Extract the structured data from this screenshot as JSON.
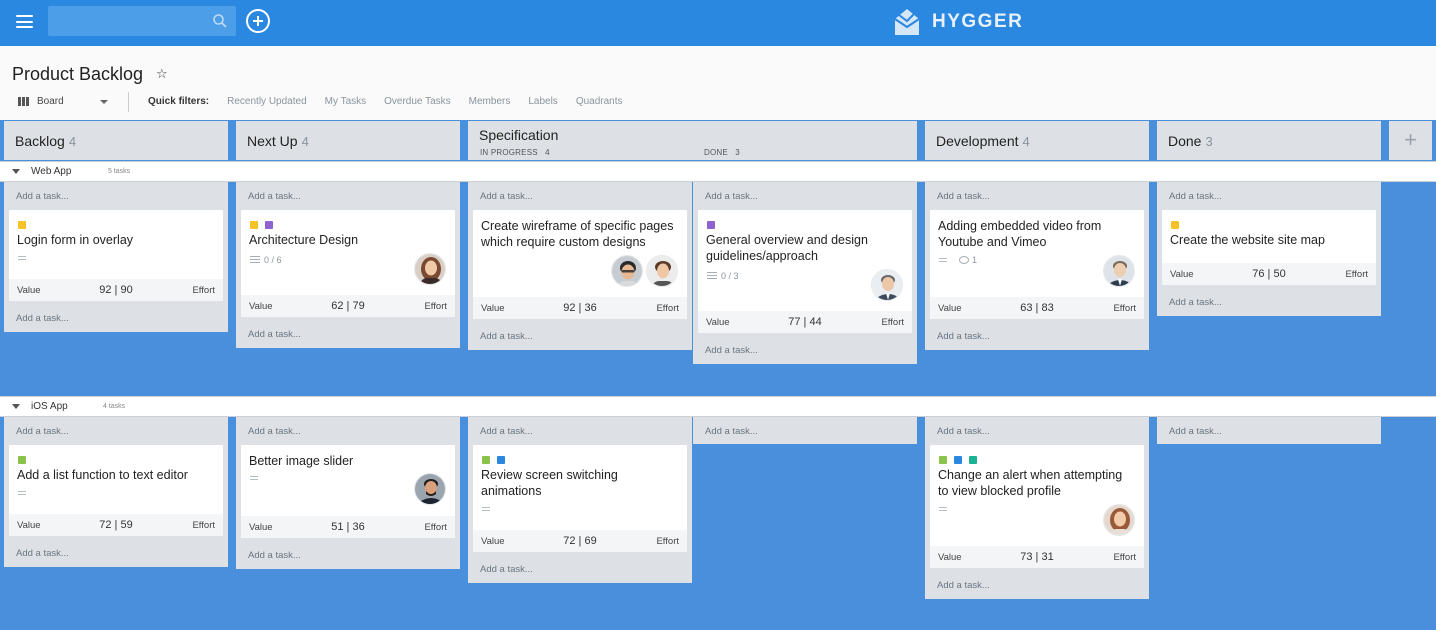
{
  "app": {
    "name": "HYGGER",
    "brand_color": "#2a88e0"
  },
  "search": {
    "placeholder": ""
  },
  "page": {
    "title": "Product Backlog"
  },
  "view": {
    "selected": "Board"
  },
  "quick_filters": {
    "label": "Quick filters:",
    "items": [
      "Recently Updated",
      "My Tasks",
      "Overdue Tasks",
      "Members",
      "Labels",
      "Quadrants"
    ]
  },
  "columns": [
    {
      "title": "Backlog",
      "count": "4"
    },
    {
      "title": "Next Up",
      "count": "4"
    },
    {
      "title": "Specification",
      "in_progress_label": "IN PROGRESS",
      "in_progress_count": "4",
      "done_label": "DONE",
      "done_count": "3"
    },
    {
      "title": "Development",
      "count": "4"
    },
    {
      "title": "Done",
      "count": "3"
    }
  ],
  "add_task_label": "Add a task...",
  "lanes": [
    {
      "name": "Web App",
      "task_count": "5 tasks"
    },
    {
      "name": "iOS App",
      "task_count": "4 tasks"
    }
  ],
  "cards": {
    "web_backlog": {
      "title": "Login form in overlay",
      "value_label": "Value",
      "score": "92 | 90",
      "effort_label": "Effort"
    },
    "web_nextup": {
      "title": "Architecture Design",
      "checklist": "0 / 6",
      "value_label": "Value",
      "score": "62 | 79",
      "effort_label": "Effort"
    },
    "web_spec_ip": {
      "title_1": "Create wireframe of specific pages",
      "title_2": "which require custom designs",
      "value_label": "Value",
      "score": "92 | 36",
      "effort_label": "Effort"
    },
    "web_spec_done": {
      "title_1": "General overview and design",
      "title_2": "guidelines/approach",
      "checklist": "0 / 3",
      "value_label": "Value",
      "score": "77 | 44",
      "effort_label": "Effort"
    },
    "web_dev": {
      "title_1": "Adding embedded video from",
      "title_2": "Youtube and Vimeo",
      "comments": "1",
      "value_label": "Value",
      "score": "63 | 83",
      "effort_label": "Effort"
    },
    "web_done": {
      "title": "Create the website site map",
      "value_label": "Value",
      "score": "76 | 50",
      "effort_label": "Effort"
    },
    "ios_backlog": {
      "title": "Add a list function to text editor",
      "value_label": "Value",
      "score": "72 | 59",
      "effort_label": "Effort"
    },
    "ios_nextup": {
      "title": "Better image slider",
      "value_label": "Value",
      "score": "51 | 36",
      "effort_label": "Effort"
    },
    "ios_spec": {
      "title_1": "Review screen switching",
      "title_2": "animations",
      "value_label": "Value",
      "score": "72 | 69",
      "effort_label": "Effort"
    },
    "ios_dev": {
      "title_1": "Change an alert when attempting",
      "title_2": "to view blocked profile",
      "value_label": "Value",
      "score": "73 | 31",
      "effort_label": "Effort"
    }
  },
  "label_colors": {
    "yellow": "#f5c325",
    "purple": "#8e63cf",
    "green": "#8bc34a",
    "blue": "#2a88e0",
    "teal": "#19b394"
  }
}
